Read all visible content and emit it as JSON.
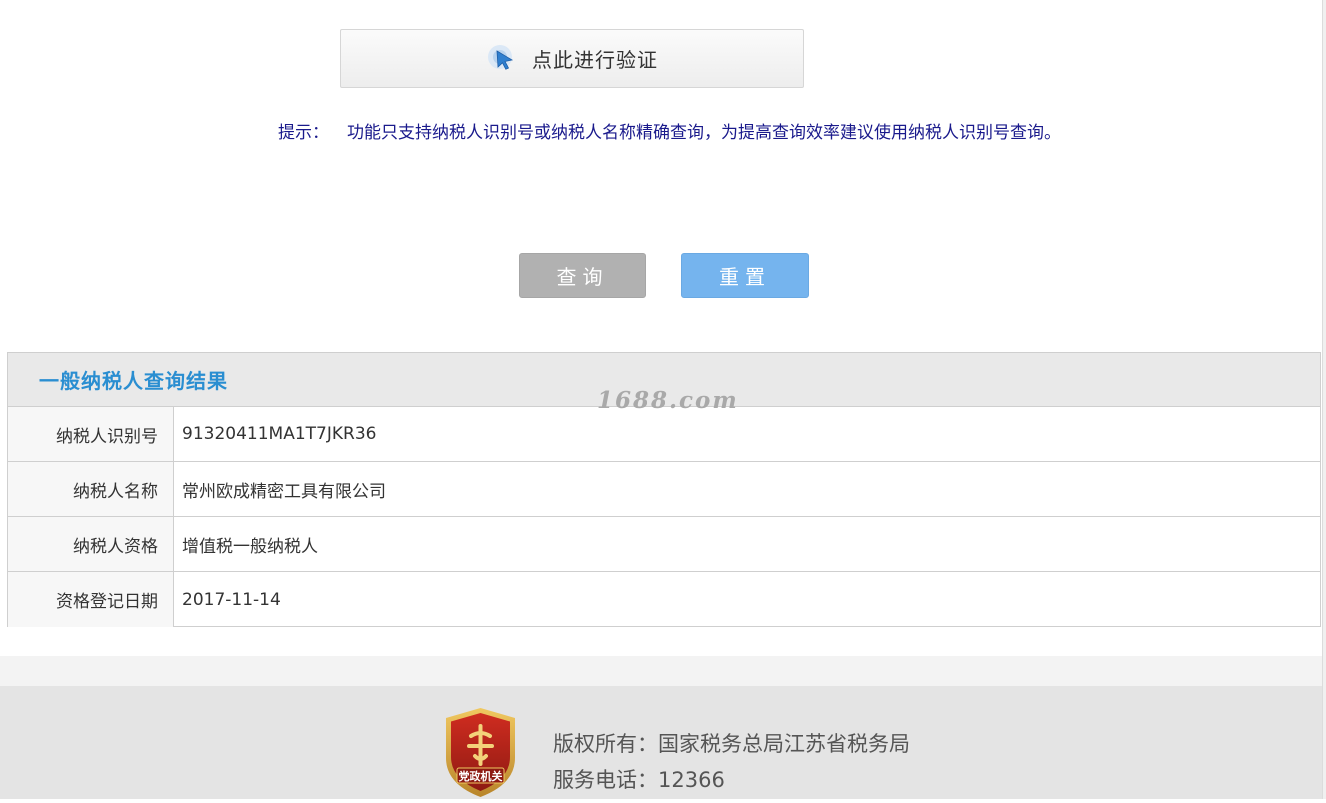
{
  "verify": {
    "label": "点此进行验证",
    "icon": "cursor-pointer-icon"
  },
  "hint": {
    "label": "提示：",
    "text": "功能只支持纳税人识别号或纳税人名称精确查询，为提高查询效率建议使用纳税人识别号查询。"
  },
  "actions": {
    "query_label": "查询",
    "reset_label": "重置"
  },
  "result": {
    "title": "一般纳税人查询结果",
    "rows": [
      {
        "label": "纳税人识别号",
        "value": "91320411MA1T7JKR36"
      },
      {
        "label": "纳税人名称",
        "value": "常州欧成精密工具有限公司"
      },
      {
        "label": "纳税人资格",
        "value": "增值税一般纳税人"
      },
      {
        "label": "资格登记日期",
        "value": "2017-11-14"
      }
    ]
  },
  "watermark": "1688.com",
  "footer": {
    "logo_text": "党政机关",
    "copyright": "版权所有：国家税务总局江苏省税务局",
    "phone": "服务电话：12366"
  },
  "colors": {
    "hint_text": "#1a1a8c",
    "result_title": "#2a8ed1",
    "query_button": "#b1b1b1",
    "reset_button": "#75b4ee",
    "logo_red": "#b8231a",
    "logo_gold": "#d9a43a"
  }
}
